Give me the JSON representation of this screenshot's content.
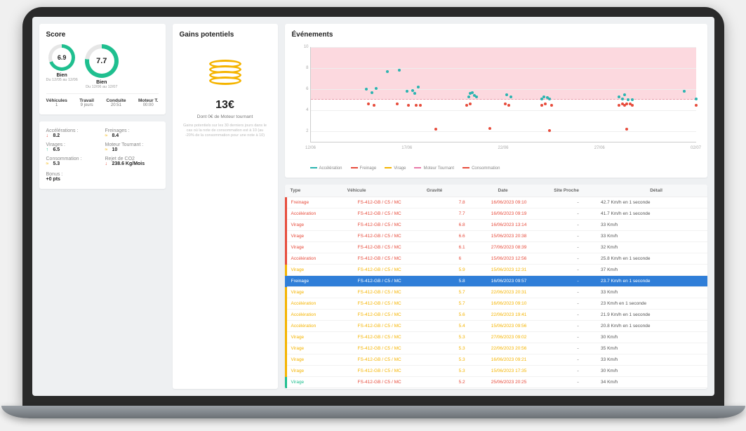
{
  "score": {
    "title": "Score",
    "gauge_prev": {
      "value": "6.9",
      "label": "Bien",
      "sub": "Du 12/05 au 12/06",
      "pct": 69
    },
    "gauge_curr": {
      "value": "7.7",
      "label": "Bien",
      "sub": "Du 12/06 au 12/07",
      "pct": 77
    },
    "stats": [
      {
        "label": "Véhicules",
        "value": "1"
      },
      {
        "label": "Travail",
        "value": "9 jours"
      },
      {
        "label": "Conduite",
        "value": "20:51"
      },
      {
        "label": "Moteur T.",
        "value": "00:00"
      }
    ],
    "metrics": [
      {
        "label": "Accélérations :",
        "arrow": "down",
        "value": "8.2"
      },
      {
        "label": "Freinages :",
        "arrow": "eq",
        "value": "8.4"
      },
      {
        "label": "Virages :",
        "arrow": "up",
        "value": "6.5"
      },
      {
        "label": "Moteur Tournant :",
        "arrow": "eq",
        "value": "10"
      },
      {
        "label": "Consommation :",
        "arrow": "eq",
        "value": "5.3"
      },
      {
        "label": "Rejet de CO2",
        "arrow": "down",
        "value": "238.6 Kg/Mois"
      }
    ],
    "bonus_label": "Bonus :",
    "bonus_value": "+0 pts"
  },
  "gains": {
    "title": "Gains potentiels",
    "amount": "13€",
    "sub": "Dont 0€ de Moteur tournant",
    "desc": "Gains potentiels sur les 30 derniers jours dans le cas où la note de consommation est à 10 (au -20% de la consommation pour une note à 10)"
  },
  "events": {
    "title": "Événements"
  },
  "chart_data": {
    "type": "scatter",
    "xlabel": "",
    "ylabel": "",
    "y_ticks": [
      2,
      4,
      6,
      8,
      10
    ],
    "x_ticks": [
      "12/06",
      "17/06",
      "22/06",
      "27/06",
      "02/07"
    ],
    "xlim": [
      0,
      20
    ],
    "ylim": [
      1,
      10
    ],
    "threshold_y": 5,
    "legend": [
      "Accélération",
      "Freinage",
      "Virage",
      "Moteur Tournant",
      "Consommation"
    ],
    "series": [
      {
        "name": "Accélération",
        "color": "teal",
        "points": [
          {
            "x": 4.0,
            "y": 7.7
          },
          {
            "x": 2.9,
            "y": 6.0
          },
          {
            "x": 3.2,
            "y": 5.7
          },
          {
            "x": 3.4,
            "y": 6.1
          },
          {
            "x": 4.6,
            "y": 7.8
          },
          {
            "x": 5.0,
            "y": 5.8
          },
          {
            "x": 5.3,
            "y": 5.9
          },
          {
            "x": 5.4,
            "y": 5.6
          },
          {
            "x": 5.6,
            "y": 6.2
          },
          {
            "x": 8.2,
            "y": 5.3
          },
          {
            "x": 8.3,
            "y": 5.6
          },
          {
            "x": 8.4,
            "y": 5.7
          },
          {
            "x": 8.5,
            "y": 5.4
          },
          {
            "x": 8.6,
            "y": 5.3
          },
          {
            "x": 10.2,
            "y": 5.5
          },
          {
            "x": 10.4,
            "y": 5.3
          },
          {
            "x": 12.0,
            "y": 5.1
          },
          {
            "x": 12.1,
            "y": 5.3
          },
          {
            "x": 12.3,
            "y": 5.2
          },
          {
            "x": 12.4,
            "y": 5.1
          },
          {
            "x": 16.0,
            "y": 5.3
          },
          {
            "x": 16.2,
            "y": 5.1
          },
          {
            "x": 16.3,
            "y": 5.5
          },
          {
            "x": 16.5,
            "y": 5.0
          },
          {
            "x": 16.7,
            "y": 5.0
          },
          {
            "x": 19.4,
            "y": 5.8
          },
          {
            "x": 20.0,
            "y": 5.1
          }
        ]
      },
      {
        "name": "Freinage",
        "color": "red",
        "points": [
          {
            "x": 3.0,
            "y": 4.6
          },
          {
            "x": 3.3,
            "y": 4.5
          },
          {
            "x": 4.5,
            "y": 4.6
          },
          {
            "x": 5.1,
            "y": 4.5
          },
          {
            "x": 5.5,
            "y": 4.5
          },
          {
            "x": 5.7,
            "y": 4.5
          },
          {
            "x": 6.5,
            "y": 2.2
          },
          {
            "x": 8.1,
            "y": 4.5
          },
          {
            "x": 8.3,
            "y": 4.6
          },
          {
            "x": 9.3,
            "y": 2.3
          },
          {
            "x": 10.1,
            "y": 4.6
          },
          {
            "x": 10.3,
            "y": 4.5
          },
          {
            "x": 12.0,
            "y": 4.5
          },
          {
            "x": 12.2,
            "y": 4.6
          },
          {
            "x": 12.5,
            "y": 4.5
          },
          {
            "x": 12.4,
            "y": 2.1
          },
          {
            "x": 16.0,
            "y": 4.5
          },
          {
            "x": 16.2,
            "y": 4.6
          },
          {
            "x": 16.3,
            "y": 4.5
          },
          {
            "x": 16.4,
            "y": 4.6
          },
          {
            "x": 16.6,
            "y": 4.6
          },
          {
            "x": 16.7,
            "y": 4.5
          },
          {
            "x": 16.4,
            "y": 2.2
          },
          {
            "x": 20.0,
            "y": 4.5
          }
        ]
      }
    ]
  },
  "table": {
    "headers": [
      "Type",
      "Véhicule",
      "Gravité",
      "Date",
      "Site Proche",
      "Détail"
    ],
    "rows": [
      {
        "type": "Freinage",
        "color": "red",
        "vehicle": "FS-412-GB / C5 / MC",
        "grav": "7.8",
        "date": "16/06/2023 09:10",
        "site": "-",
        "detail": "42.7 Km/h en 1 seconde",
        "sel": false
      },
      {
        "type": "Accélération",
        "color": "red",
        "vehicle": "FS-412-GB / C5 / MC",
        "grav": "7.7",
        "date": "16/06/2023 09:19",
        "site": "-",
        "detail": "41.7 Km/h en 1 seconde",
        "sel": false
      },
      {
        "type": "Virage",
        "color": "red",
        "vehicle": "FS-412-GB / C5 / MC",
        "grav": "6.8",
        "date": "16/06/2023 13:14",
        "site": "-",
        "detail": "33 Km/h",
        "sel": false
      },
      {
        "type": "Virage",
        "color": "red",
        "vehicle": "FS-412-GB / C5 / MC",
        "grav": "6.6",
        "date": "15/06/2023 20:38",
        "site": "-",
        "detail": "33 Km/h",
        "sel": false
      },
      {
        "type": "Virage",
        "color": "red",
        "vehicle": "FS-412-GB / C5 / MC",
        "grav": "6.1",
        "date": "27/06/2023 08:39",
        "site": "-",
        "detail": "32 Km/h",
        "sel": false
      },
      {
        "type": "Accélération",
        "color": "red",
        "vehicle": "FS-412-GB / C5 / MC",
        "grav": "6",
        "date": "15/06/2023 12:56",
        "site": "-",
        "detail": "25.8 Km/h en 1 seconde",
        "sel": false
      },
      {
        "type": "Virage",
        "color": "orange",
        "vehicle": "FS-412-GB / C5 / MC",
        "grav": "5.9",
        "date": "15/06/2023 12:31",
        "site": "-",
        "detail": "37 Km/h",
        "sel": false
      },
      {
        "type": "Freinage",
        "color": "red",
        "vehicle": "FS-412-GB / C5 / MC",
        "grav": "5.8",
        "date": "16/06/2023 09:57",
        "site": "-",
        "detail": "23.7 Km/h en 1 seconde",
        "sel": true
      },
      {
        "type": "Virage",
        "color": "orange",
        "vehicle": "FS-412-GB / C5 / MC",
        "grav": "5.7",
        "date": "22/06/2023 20:31",
        "site": "-",
        "detail": "33 Km/h",
        "sel": false
      },
      {
        "type": "Accélération",
        "color": "orange",
        "vehicle": "FS-412-GB / C5 / MC",
        "grav": "5.7",
        "date": "16/06/2023 09:10",
        "site": "-",
        "detail": "23 Km/h en 1 seconde",
        "sel": false
      },
      {
        "type": "Accélération",
        "color": "orange",
        "vehicle": "FS-412-GB / C5 / MC",
        "grav": "5.6",
        "date": "22/06/2023 19:41",
        "site": "-",
        "detail": "21.9 Km/h en 1 seconde",
        "sel": false
      },
      {
        "type": "Accélération",
        "color": "orange",
        "vehicle": "FS-412-GB / C5 / MC",
        "grav": "5.4",
        "date": "15/06/2023 09:56",
        "site": "-",
        "detail": "20.8 Km/h en 1 seconde",
        "sel": false
      },
      {
        "type": "Virage",
        "color": "orange",
        "vehicle": "FS-412-GB / C5 / MC",
        "grav": "5.3",
        "date": "27/06/2023 09:02",
        "site": "-",
        "detail": "30 Km/h",
        "sel": false
      },
      {
        "type": "Virage",
        "color": "orange",
        "vehicle": "FS-412-GB / C5 / MC",
        "grav": "5.3",
        "date": "22/06/2023 20:56",
        "site": "-",
        "detail": "35 Km/h",
        "sel": false
      },
      {
        "type": "Virage",
        "color": "orange",
        "vehicle": "FS-412-GB / C5 / MC",
        "grav": "5.3",
        "date": "16/06/2023 09:21",
        "site": "-",
        "detail": "33 Km/h",
        "sel": false
      },
      {
        "type": "Virage",
        "color": "orange",
        "vehicle": "FS-412-GB / C5 / MC",
        "grav": "5.3",
        "date": "15/06/2023 17:35",
        "site": "-",
        "detail": "30 Km/h",
        "sel": false
      },
      {
        "type": "Virage",
        "color": "green",
        "vehicle": "FS-412-GB / C5 / MC",
        "grav": "5.2",
        "date": "25/06/2023 20:25",
        "site": "-",
        "detail": "34 Km/h",
        "sel": false
      }
    ]
  }
}
